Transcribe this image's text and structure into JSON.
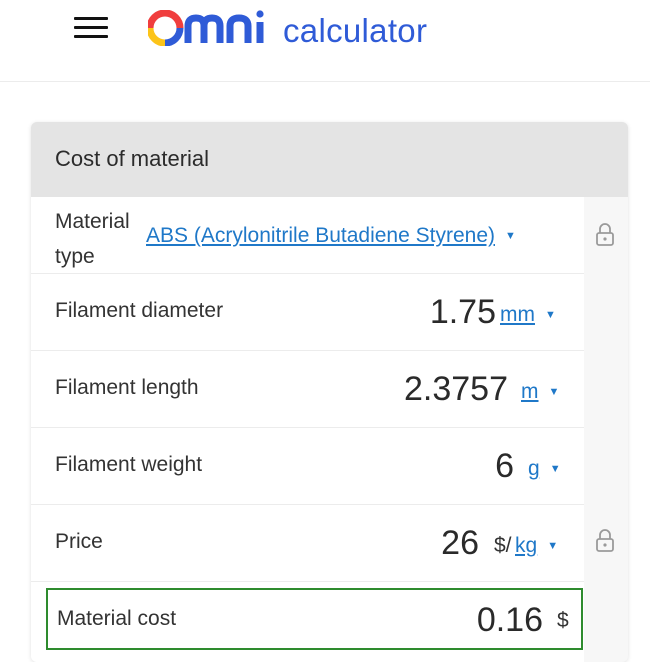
{
  "header": {
    "logo_brand": "omni",
    "logo_text": "calculator",
    "brand_colors": [
      "#f03e3e",
      "#fcc419",
      "#2f5bd7"
    ]
  },
  "card": {
    "title": "Cost of material",
    "rows": [
      {
        "label": "Material type",
        "select_value": "ABS (Acrylonitrile Butadiene Styrene)",
        "locked": true
      },
      {
        "label": "Filament diameter",
        "value": "1.75",
        "unit": "mm"
      },
      {
        "label": "Filament length",
        "value": "2.3757",
        "unit": "m"
      },
      {
        "label": "Filament weight",
        "value": "6",
        "unit": "g"
      },
      {
        "label": "Price",
        "value": "26",
        "unit_prefix": "$/",
        "unit": "kg",
        "locked": true
      },
      {
        "label": "Material cost",
        "value": "0.16",
        "unit": "$"
      }
    ]
  },
  "icons": {
    "menu": "hamburger-icon",
    "lock": "lock-icon",
    "dropdown": "caret-down-icon"
  },
  "colors": {
    "link": "#1f78c8",
    "result_border": "#2e8b2e",
    "header_bg": "#e4e4e4"
  }
}
